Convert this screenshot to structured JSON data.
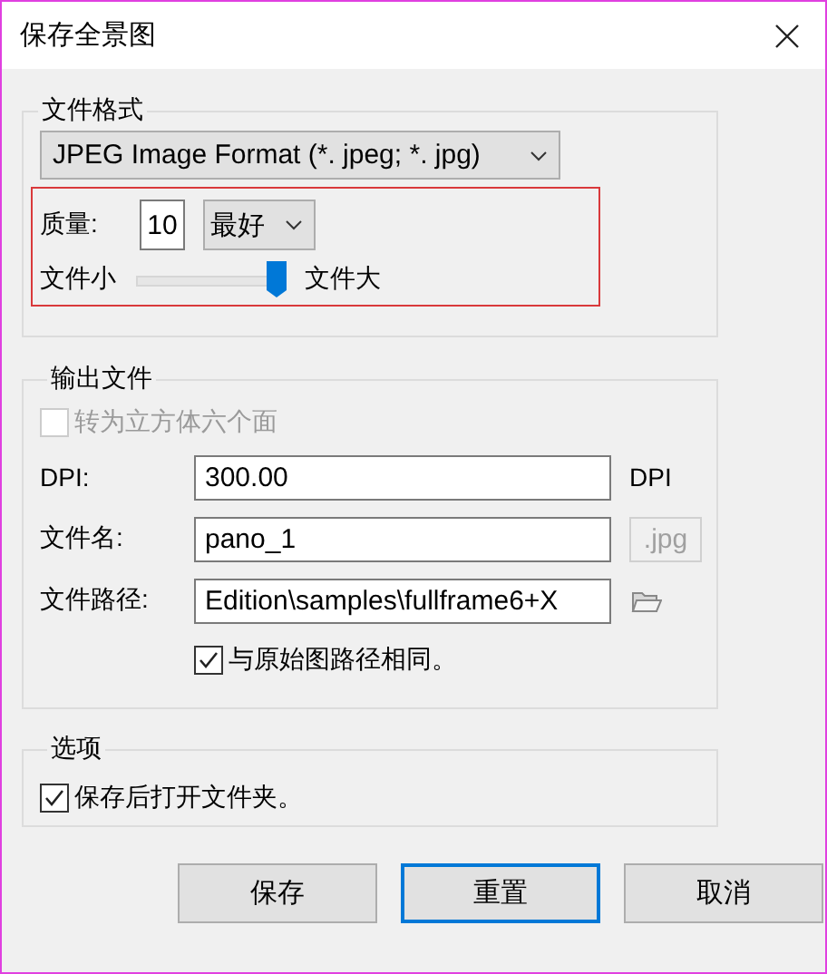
{
  "window": {
    "title": "保存全景图"
  },
  "format_group": {
    "title": "文件格式",
    "format": {
      "value": "JPEG Image Format (*. jpeg; *. jpg)"
    },
    "quality": {
      "label": "质量:",
      "value": "10",
      "preset": "最好"
    },
    "size_slider": {
      "min_label": "文件小",
      "max_label": "文件大",
      "level": 1
    }
  },
  "output_group": {
    "title": "输出文件",
    "cube_checkbox": {
      "label": "转为立方体六个面",
      "checked": false,
      "disabled": true
    },
    "dpi": {
      "label": "DPI:",
      "value": "300.00",
      "unit": "DPI"
    },
    "file_name": {
      "label": "文件名:",
      "value": "pano_1",
      "extension": ".jpg"
    },
    "file_path": {
      "label": "文件路径:",
      "value": "Edition\\samples\\fullframe6+X"
    },
    "same_path_checkbox": {
      "label": "与原始图路径相同。",
      "checked": true,
      "disabled": false
    }
  },
  "options_group": {
    "title": "选项",
    "open_folder_checkbox": {
      "label": "保存后打开文件夹。",
      "checked": true,
      "disabled": false
    }
  },
  "buttons": [
    {
      "label": "保存",
      "focused": false
    },
    {
      "label": "重置",
      "focused": true
    },
    {
      "label": "取消",
      "focused": false
    }
  ]
}
